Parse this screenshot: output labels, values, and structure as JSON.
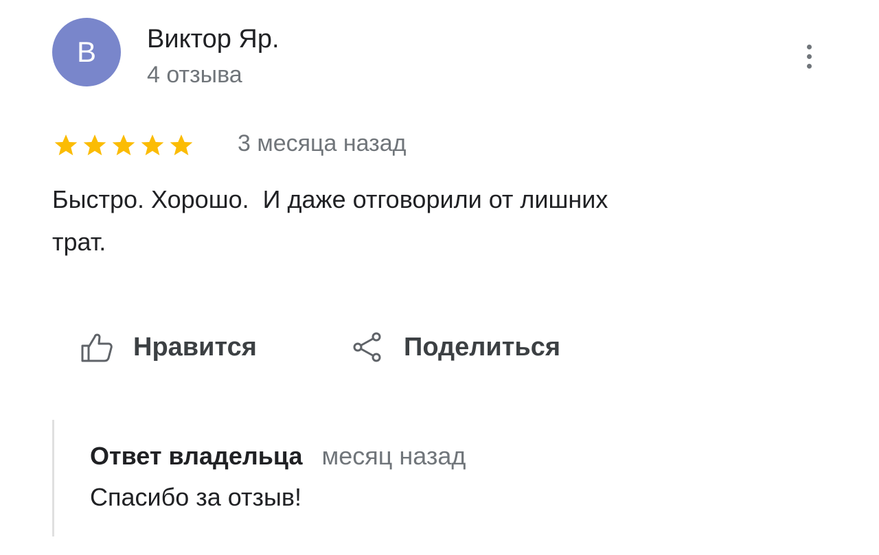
{
  "review": {
    "author": {
      "avatar_letter": "В",
      "avatar_color": "#7986cb",
      "name": "Виктор Яр.",
      "meta": "4 отзыва"
    },
    "menu_icon": "more-vert-icon",
    "rating": 5,
    "rating_max": 5,
    "star_color": "#fbbc04",
    "date": "3 месяца назад",
    "text": "Быстро. Хорошо.  И даже отговорили от лишних\nтрат."
  },
  "actions": {
    "like": {
      "label": "Нравится",
      "icon": "thumbs-up-icon"
    },
    "share": {
      "label": "Поделиться",
      "icon": "share-icon"
    }
  },
  "owner_reply": {
    "title": "Ответ владельца",
    "date": "месяц назад",
    "text": "Спасибо за отзыв!"
  }
}
